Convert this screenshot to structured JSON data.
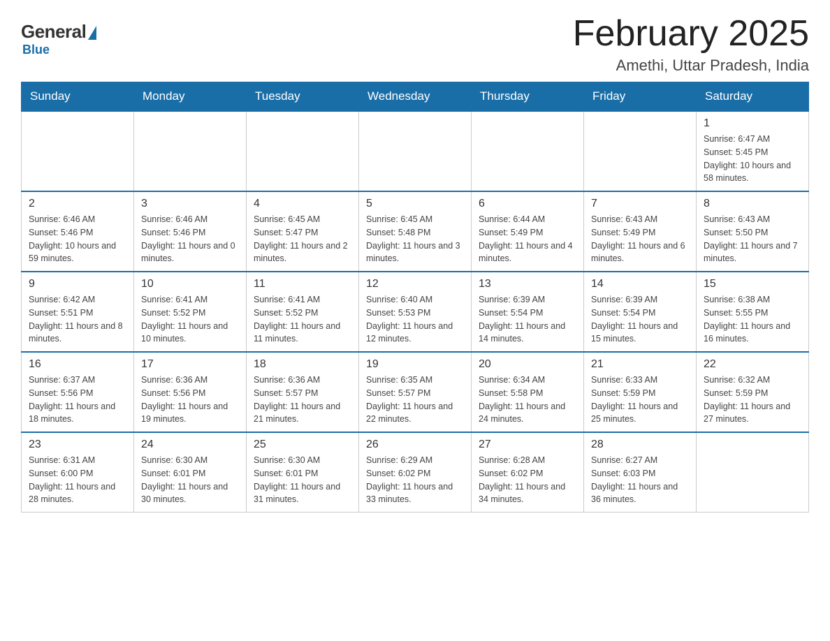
{
  "logo": {
    "general": "General",
    "blue": "Blue"
  },
  "header": {
    "title": "February 2025",
    "subtitle": "Amethi, Uttar Pradesh, India"
  },
  "days_of_week": [
    "Sunday",
    "Monday",
    "Tuesday",
    "Wednesday",
    "Thursday",
    "Friday",
    "Saturday"
  ],
  "weeks": [
    [
      {
        "day": "",
        "info": ""
      },
      {
        "day": "",
        "info": ""
      },
      {
        "day": "",
        "info": ""
      },
      {
        "day": "",
        "info": ""
      },
      {
        "day": "",
        "info": ""
      },
      {
        "day": "",
        "info": ""
      },
      {
        "day": "1",
        "info": "Sunrise: 6:47 AM\nSunset: 5:45 PM\nDaylight: 10 hours and 58 minutes."
      }
    ],
    [
      {
        "day": "2",
        "info": "Sunrise: 6:46 AM\nSunset: 5:46 PM\nDaylight: 10 hours and 59 minutes."
      },
      {
        "day": "3",
        "info": "Sunrise: 6:46 AM\nSunset: 5:46 PM\nDaylight: 11 hours and 0 minutes."
      },
      {
        "day": "4",
        "info": "Sunrise: 6:45 AM\nSunset: 5:47 PM\nDaylight: 11 hours and 2 minutes."
      },
      {
        "day": "5",
        "info": "Sunrise: 6:45 AM\nSunset: 5:48 PM\nDaylight: 11 hours and 3 minutes."
      },
      {
        "day": "6",
        "info": "Sunrise: 6:44 AM\nSunset: 5:49 PM\nDaylight: 11 hours and 4 minutes."
      },
      {
        "day": "7",
        "info": "Sunrise: 6:43 AM\nSunset: 5:49 PM\nDaylight: 11 hours and 6 minutes."
      },
      {
        "day": "8",
        "info": "Sunrise: 6:43 AM\nSunset: 5:50 PM\nDaylight: 11 hours and 7 minutes."
      }
    ],
    [
      {
        "day": "9",
        "info": "Sunrise: 6:42 AM\nSunset: 5:51 PM\nDaylight: 11 hours and 8 minutes."
      },
      {
        "day": "10",
        "info": "Sunrise: 6:41 AM\nSunset: 5:52 PM\nDaylight: 11 hours and 10 minutes."
      },
      {
        "day": "11",
        "info": "Sunrise: 6:41 AM\nSunset: 5:52 PM\nDaylight: 11 hours and 11 minutes."
      },
      {
        "day": "12",
        "info": "Sunrise: 6:40 AM\nSunset: 5:53 PM\nDaylight: 11 hours and 12 minutes."
      },
      {
        "day": "13",
        "info": "Sunrise: 6:39 AM\nSunset: 5:54 PM\nDaylight: 11 hours and 14 minutes."
      },
      {
        "day": "14",
        "info": "Sunrise: 6:39 AM\nSunset: 5:54 PM\nDaylight: 11 hours and 15 minutes."
      },
      {
        "day": "15",
        "info": "Sunrise: 6:38 AM\nSunset: 5:55 PM\nDaylight: 11 hours and 16 minutes."
      }
    ],
    [
      {
        "day": "16",
        "info": "Sunrise: 6:37 AM\nSunset: 5:56 PM\nDaylight: 11 hours and 18 minutes."
      },
      {
        "day": "17",
        "info": "Sunrise: 6:36 AM\nSunset: 5:56 PM\nDaylight: 11 hours and 19 minutes."
      },
      {
        "day": "18",
        "info": "Sunrise: 6:36 AM\nSunset: 5:57 PM\nDaylight: 11 hours and 21 minutes."
      },
      {
        "day": "19",
        "info": "Sunrise: 6:35 AM\nSunset: 5:57 PM\nDaylight: 11 hours and 22 minutes."
      },
      {
        "day": "20",
        "info": "Sunrise: 6:34 AM\nSunset: 5:58 PM\nDaylight: 11 hours and 24 minutes."
      },
      {
        "day": "21",
        "info": "Sunrise: 6:33 AM\nSunset: 5:59 PM\nDaylight: 11 hours and 25 minutes."
      },
      {
        "day": "22",
        "info": "Sunrise: 6:32 AM\nSunset: 5:59 PM\nDaylight: 11 hours and 27 minutes."
      }
    ],
    [
      {
        "day": "23",
        "info": "Sunrise: 6:31 AM\nSunset: 6:00 PM\nDaylight: 11 hours and 28 minutes."
      },
      {
        "day": "24",
        "info": "Sunrise: 6:30 AM\nSunset: 6:01 PM\nDaylight: 11 hours and 30 minutes."
      },
      {
        "day": "25",
        "info": "Sunrise: 6:30 AM\nSunset: 6:01 PM\nDaylight: 11 hours and 31 minutes."
      },
      {
        "day": "26",
        "info": "Sunrise: 6:29 AM\nSunset: 6:02 PM\nDaylight: 11 hours and 33 minutes."
      },
      {
        "day": "27",
        "info": "Sunrise: 6:28 AM\nSunset: 6:02 PM\nDaylight: 11 hours and 34 minutes."
      },
      {
        "day": "28",
        "info": "Sunrise: 6:27 AM\nSunset: 6:03 PM\nDaylight: 11 hours and 36 minutes."
      },
      {
        "day": "",
        "info": ""
      }
    ]
  ]
}
